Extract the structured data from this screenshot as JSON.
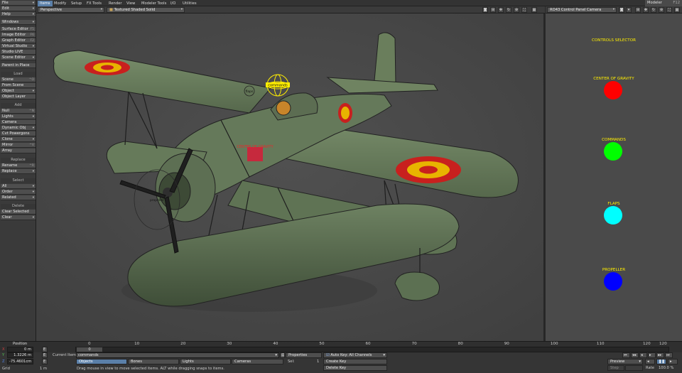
{
  "left_toolbar": {
    "menus": [
      {
        "label": "File"
      },
      {
        "label": "Edit"
      },
      {
        "label": "Help"
      }
    ],
    "windows_label": "Windows",
    "editors": [
      {
        "label": "Surface Editor",
        "shortcut": "F5"
      },
      {
        "label": "Image Editor",
        "shortcut": "F6"
      },
      {
        "label": "Graph Editor",
        "shortcut": "F2"
      },
      {
        "label": "Virtual Studio",
        "shortcut": ""
      },
      {
        "label": "Studio LIVE",
        "shortcut": ""
      },
      {
        "label": "Scene Editor",
        "shortcut": ""
      }
    ],
    "parent_in_place": "Parent in Place",
    "load_header": "Load",
    "load_items": [
      {
        "label": "Scene",
        "shortcut": "^O"
      },
      {
        "label": "From Scene",
        "shortcut": ""
      },
      {
        "label": "Object",
        "shortcut": ""
      },
      {
        "label": "Object Layer",
        "shortcut": ""
      }
    ],
    "add_header": "Add",
    "add_items": [
      {
        "label": "Null",
        "shortcut": "^N"
      },
      {
        "label": "Lights",
        "shortcut": ""
      },
      {
        "label": "Camera",
        "shortcut": ""
      },
      {
        "label": "Dynamic Obj",
        "shortcut": ""
      },
      {
        "label": "Cvt Powergons",
        "shortcut": ""
      },
      {
        "label": "Clone",
        "shortcut": ""
      },
      {
        "label": "Mirror",
        "shortcut": "^V"
      },
      {
        "label": "Array",
        "shortcut": ""
      }
    ],
    "replace_header": "Replace",
    "replace_items": [
      {
        "label": "Rename",
        "shortcut": "^R"
      },
      {
        "label": "Replace",
        "shortcut": ""
      }
    ],
    "select_header": "Select",
    "select_items": [
      {
        "label": "All"
      },
      {
        "label": "Order"
      },
      {
        "label": "Related"
      }
    ],
    "delete_header": "Delete",
    "delete_items": [
      {
        "label": "Clear Selected"
      },
      {
        "label": "Clear"
      }
    ]
  },
  "tabs": [
    "Items",
    "Modify",
    "Setup",
    "FX Tools",
    "Render",
    "View",
    "Modeler Tools",
    "I/O",
    "Utilities"
  ],
  "active_tab": "Items",
  "modeler": {
    "label": "Modeler",
    "shortcut": "F12"
  },
  "viewport": {
    "view_mode": "Perspective",
    "render_mode": "Textured Shaded Solid",
    "scene_labels": {
      "commands": "commands",
      "flaps": "flaps",
      "center_of_gravity": "CENTER OF GRAVITY",
      "propeller": "propeller"
    }
  },
  "right_panel": {
    "camera": "RO43 Control Panel Camera",
    "selector_title": "CONTROLS SELECTOR",
    "controls": [
      {
        "label": "CENTER OF GRAVITY",
        "color": "#ff0000"
      },
      {
        "label": "COMMANDS",
        "color": "#00ff00"
      },
      {
        "label": "FLAPS",
        "color": "#00ffff"
      },
      {
        "label": "PROPELLER",
        "color": "#0000ff"
      }
    ]
  },
  "timeline": {
    "frame_value": "0",
    "ticks": [
      "0",
      "10",
      "20",
      "30",
      "40",
      "50",
      "60",
      "70",
      "80",
      "90",
      "100",
      "110",
      "120"
    ],
    "end_frame": "120"
  },
  "bottom": {
    "position_label": "Position",
    "x_label": "X",
    "x_value": "0 m",
    "y_label": "Y",
    "y_value": "1.3226 m",
    "z_label": "Z",
    "z_value": "-75.4601cm",
    "grid_label": "Grid",
    "grid_value": "1 m",
    "current_item_label": "Current Item",
    "current_item_value": "commands",
    "filters": [
      "Objects",
      "Bones",
      "Lights",
      "Cameras"
    ],
    "properties_label": "Properties",
    "sel_label": "Sel:",
    "sel_value": "1",
    "auto_key": "Auto Key: All Channels",
    "create_key": "Create Key",
    "delete_key": "Delete Key",
    "status_message": "Drag mouse in view to move selected items. ALT while dragging snaps to items.",
    "preview_label": "Preview",
    "step_label": "Step",
    "rate_label": "Rate",
    "rate_value": "100.0 %"
  },
  "colors": {
    "roundel_red": "#c8201e",
    "roundel_yellow": "#e8b400",
    "plane_green": "#6b7f5e",
    "accent": "#5a7fa8"
  }
}
